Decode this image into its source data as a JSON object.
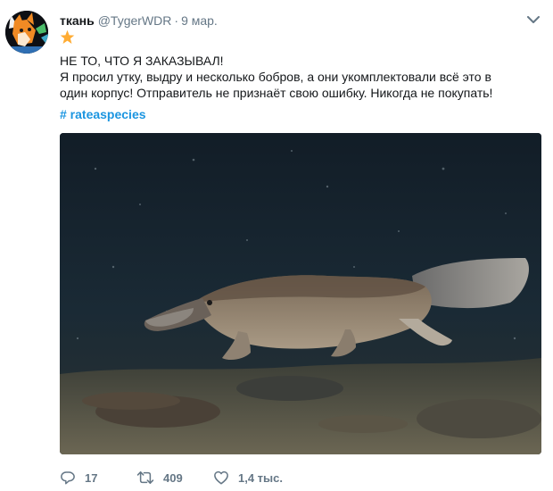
{
  "tweet": {
    "author": {
      "display_name": "ткань",
      "handle": "@TygerWDR"
    },
    "separator": "·",
    "date": "9 мар.",
    "icons": {
      "avatar": "avatar-image",
      "star": "star-icon",
      "caret": "chevron-down-icon"
    },
    "text_lines": [
      "НЕ ТО, ЧТО Я ЗАКАЗЫВАЛ!",
      "Я просил утку, выдру и несколько бобров, а они укомплектовали всё это в",
      "один корпус! Отправитель не признаёт свою ошибку. Никогда не покупать!"
    ],
    "hashtag": "# rateaspecies",
    "media": {
      "subject": "platypus-photo"
    },
    "actions": {
      "reply": {
        "icon": "reply-icon",
        "count": "17"
      },
      "retweet": {
        "icon": "retweet-icon",
        "count": "409"
      },
      "like": {
        "icon": "heart-icon",
        "count": "1,4 тыс."
      }
    },
    "colors": {
      "link": "#1b95e0",
      "muted": "#657786",
      "star": "#ffac33"
    }
  }
}
